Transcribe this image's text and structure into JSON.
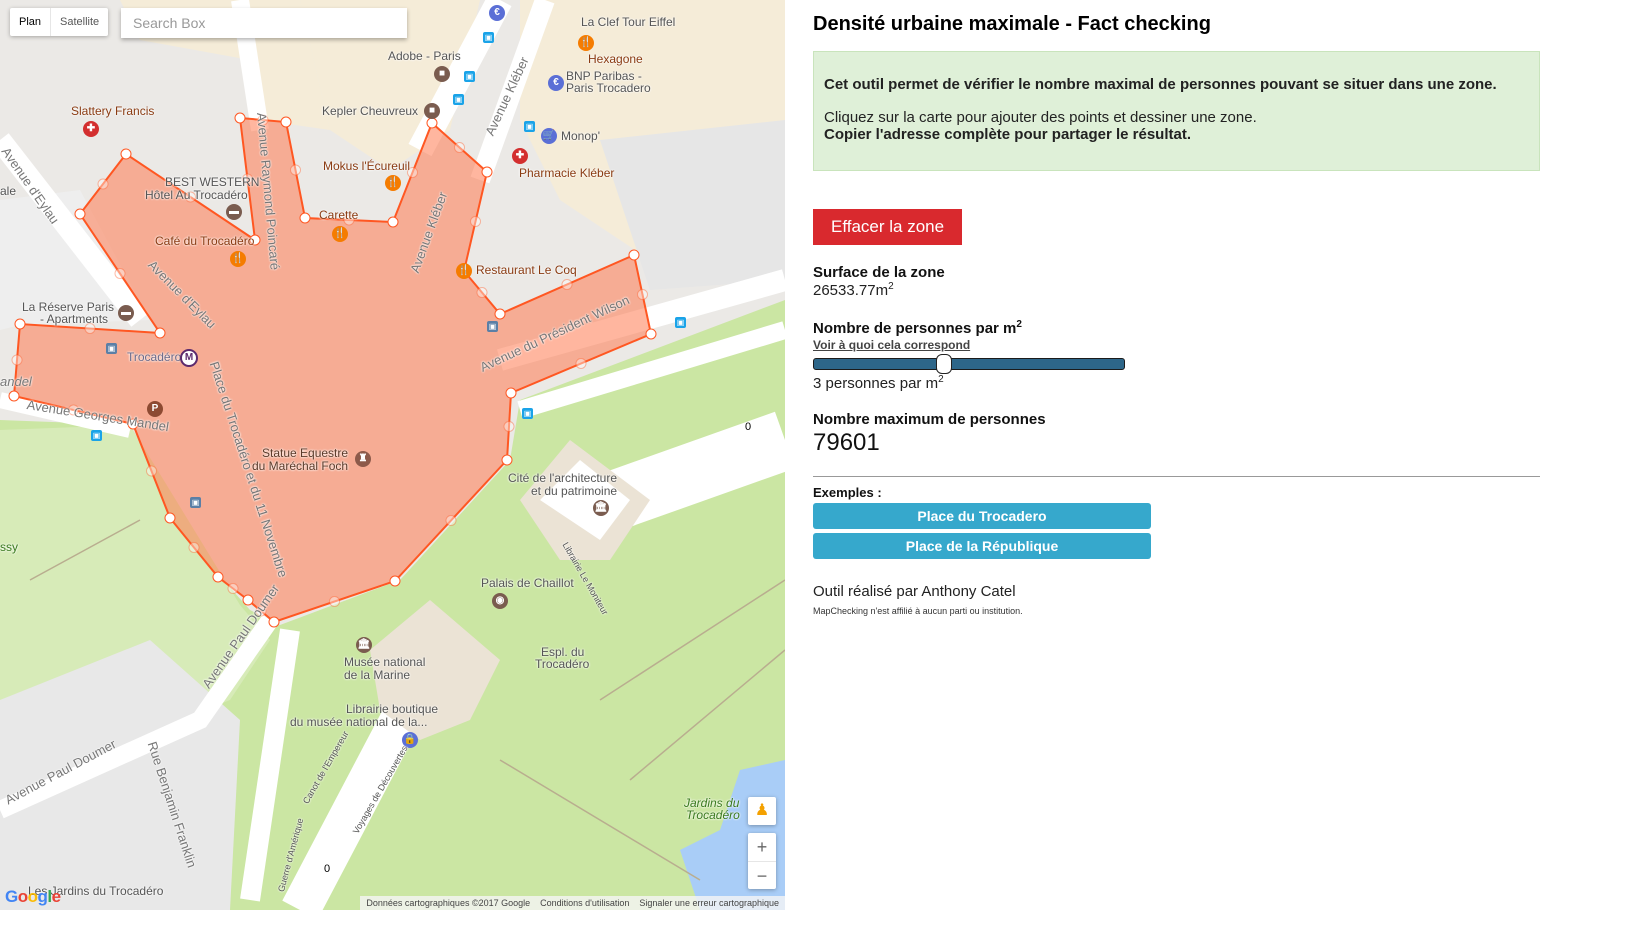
{
  "map": {
    "map_types": [
      "Plan",
      "Satellite"
    ],
    "active_map_type": "Plan",
    "search": {
      "placeholder": "Search Box",
      "value": ""
    },
    "labels": {
      "slattery": "Slattery Francis",
      "bestwestern1": "BEST WESTERN",
      "bestwestern2": "Hôtel Au Trocadéro",
      "cafe": "Café du Trocadéro",
      "reserve1": "La Réserve Paris",
      "reserve2": "- Apartments",
      "trocadero_metro": "Trocadéro",
      "adobe": "Adobe - Paris",
      "kepler": "Kepler Cheuvreux",
      "mokus": "Mokus l'Écureuil",
      "carette": "Carette",
      "clef": "La Clef Tour Eiffel",
      "hexagone": "Hexagone",
      "bnp1": "BNP Paribas -",
      "bnp2": "Paris Trocadero",
      "monop": "Monop'",
      "pharmacie": "Pharmacie Kléber",
      "lecoq": "Restaurant Le Coq",
      "statue1": "Statue Equestre",
      "statue2": "du Maréchal Foch",
      "cite1": "Cité de l'architecture",
      "cite2": "et du patrimoine",
      "librairie_moniteur": "Librairie Le Moniteur",
      "chaillot": "Palais de Chaillot",
      "espl1": "Espl. du",
      "espl2": "Trocadéro",
      "musee1": "Musée national",
      "musee2": "de la Marine",
      "boutique1": "Librairie boutique",
      "boutique2": "du musée national de la...",
      "jardins1": "Jardins du",
      "jardins2": "Trocadéro",
      "jardins_bottom": "Les Jardins du Trocadéro",
      "canot": "Canot de l'Empereur",
      "voyages": "Voyages de Découvertes",
      "guerre": "Guerre d'Amérique",
      "ssy": "ssy",
      "ale": "ale",
      "andel": "andel"
    },
    "roads": {
      "eylau_nw": "Avenue d'Eylau",
      "eylau": "Avenue d'Eylau",
      "poincare": "Avenue Raymond Poincaré",
      "kleber_top": "Avenue Kléber",
      "kleber": "Avenue Kléber",
      "wilson": "Avenue du Président Wilson",
      "mandel": "Avenue Georges Mandel",
      "place": "Place du Trocadéro et du 11 Novembre",
      "doumer": "Avenue Paul Doumer",
      "doumer2": "Avenue Paul Doumer",
      "franklin": "Rue Benjamin Franklin"
    },
    "scale_markers": [
      "0",
      "0"
    ],
    "zoom_in": "+",
    "zoom_out": "−",
    "google_logo": "Google",
    "attribution": {
      "data": "Données cartographiques ©2017 Google",
      "terms": "Conditions d'utilisation",
      "report": "Signaler une erreur cartographique"
    },
    "polygon_color": "#ff5722"
  },
  "panel": {
    "title": "Densité urbaine maximale - Fact checking",
    "info": {
      "line1": "Cet outil permet de vérifier le nombre maximal de personnes pouvant se situer dans une zone.",
      "line2": "Cliquez sur la carte pour ajouter des points et dessiner une zone.",
      "line3": "Copier l'adresse complète pour partager le résultat."
    },
    "clear_button": "Effacer la zone",
    "surface": {
      "label": "Surface de la zone",
      "value": "26533.77m",
      "unit_exp": "2"
    },
    "density": {
      "label": "Nombre de personnes par m",
      "label_exp": "2",
      "link": "Voir à quoi cela correspond",
      "slider_value": 3,
      "slider_fraction": 0.42,
      "value_text": "3 personnes par m",
      "value_exp": "2"
    },
    "max_people": {
      "label": "Nombre maximum de personnes",
      "value": "79601"
    },
    "examples": {
      "label": "Exemples :",
      "buttons": [
        "Place du Trocadero",
        "Place de la République"
      ]
    },
    "author": "Outil réalisé par Anthony Catel",
    "disclaimer": "MapChecking n'est affilié à aucun parti ou institution.",
    "colors": {
      "clear_button": "#d9292e",
      "example_button": "#36a8cc",
      "info_bg": "#dff0d8",
      "slider": "#2d6689"
    }
  }
}
